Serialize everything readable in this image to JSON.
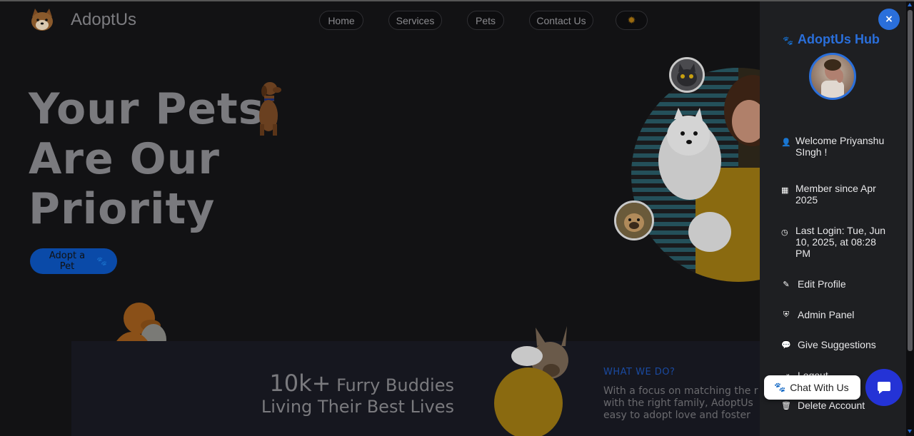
{
  "navbar": {
    "brand": "AdoptUs",
    "links": [
      "Home",
      "Services",
      "Pets",
      "Contact Us"
    ],
    "theme_toggle_icon": "sun-icon"
  },
  "hero": {
    "title_lines": [
      "Your Pets",
      "Are Our",
      "Priority"
    ],
    "adopt_button": "Adopt a Pet",
    "adopt_icon": "paw-icon"
  },
  "stats": {
    "count": "10k+",
    "line1_rest": " Furry Buddies",
    "line2": "Living Their Best Lives"
  },
  "about": {
    "heading": "WHAT WE DO?",
    "lines": [
      "With a focus on matching the r",
      "with the right family, AdoptUs",
      "easy to adopt love and foster"
    ]
  },
  "sidebar": {
    "close_label": "×",
    "title": "AdoptUs Hub",
    "info": [
      {
        "icon": "user-icon",
        "text": "Welcome Priyanshu SIngh !"
      },
      {
        "icon": "calendar-icon",
        "text": "Member since Apr 2025"
      },
      {
        "icon": "clock-icon",
        "text": "Last Login: Tue, Jun 10, 2025, at 08:28 PM"
      }
    ],
    "menu": [
      {
        "icon": "user-edit-icon",
        "label": "Edit Profile"
      },
      {
        "icon": "user-shield-icon",
        "label": "Admin Panel"
      },
      {
        "icon": "comment-icon",
        "label": "Give Suggestions"
      },
      {
        "icon": "logout-icon",
        "label": "Logout"
      },
      {
        "icon": "trash-icon",
        "label": "Delete Account"
      }
    ]
  },
  "chat": {
    "label": "Chat With Us",
    "icon": "paw-icon",
    "fab_icon": "chat-bubble-icon"
  },
  "colors": {
    "accent": "#2a6fdb",
    "chat_fab": "#2433d6",
    "background": "#121214",
    "sidebar_bg": "#1e1f22"
  }
}
